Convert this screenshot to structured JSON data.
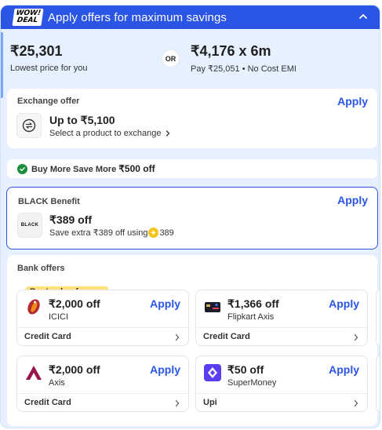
{
  "header": {
    "badge_line1": "WOW!",
    "badge_line2": "DEAL",
    "title": "Apply offers for maximum savings",
    "collapse_icon": "chevron-up-icon"
  },
  "price": {
    "price": "₹25,301",
    "price_caption": "Lowest price for you",
    "or_label": "OR",
    "emi": "₹4,176 x 6m",
    "emi_caption": "Pay ₹25,051 • No Cost EMI"
  },
  "exchange": {
    "title": "Exchange offer",
    "apply": "Apply",
    "amount": "Up to ₹5,100",
    "sub": "Select a product to exchange",
    "icon": "exchange-icon"
  },
  "buy_more": {
    "label": "Buy More Save More",
    "amount": "₹500 off"
  },
  "black": {
    "title": "BLACK Benefit",
    "apply": "Apply",
    "logo_text": "BLACK",
    "amount": "₹389 off",
    "sub_prefix": "Save extra ₹389 off using",
    "coins": "389"
  },
  "bank": {
    "title": "Bank offers",
    "best_tag": "Best value for you",
    "offers": [
      {
        "amount": "₹2,000 off",
        "bank": "ICICI",
        "apply": "Apply",
        "type": "Credit Card",
        "logo": "icici-logo-icon",
        "color": "#b02a30"
      },
      {
        "amount": "₹1,366 off",
        "bank": "Flipkart Axis",
        "apply": "Apply",
        "type": "Credit Card",
        "logo": "flipkart-axis-card-icon",
        "color": "#222222"
      },
      {
        "amount": "₹2,000 off",
        "bank": "Axis",
        "apply": "Apply",
        "type": "Credit Card",
        "logo": "axis-logo-icon",
        "color": "#97144d"
      },
      {
        "amount": "₹50 off",
        "bank": "SuperMoney",
        "apply": "Apply",
        "type": "Upi",
        "logo": "supermoney-logo-icon",
        "color": "#5a3ff0"
      }
    ]
  },
  "colors": {
    "accent": "#2a55e5",
    "panel_bg": "#e6f0ff",
    "success": "#1a8e3c",
    "tag": "#ffe07a"
  }
}
